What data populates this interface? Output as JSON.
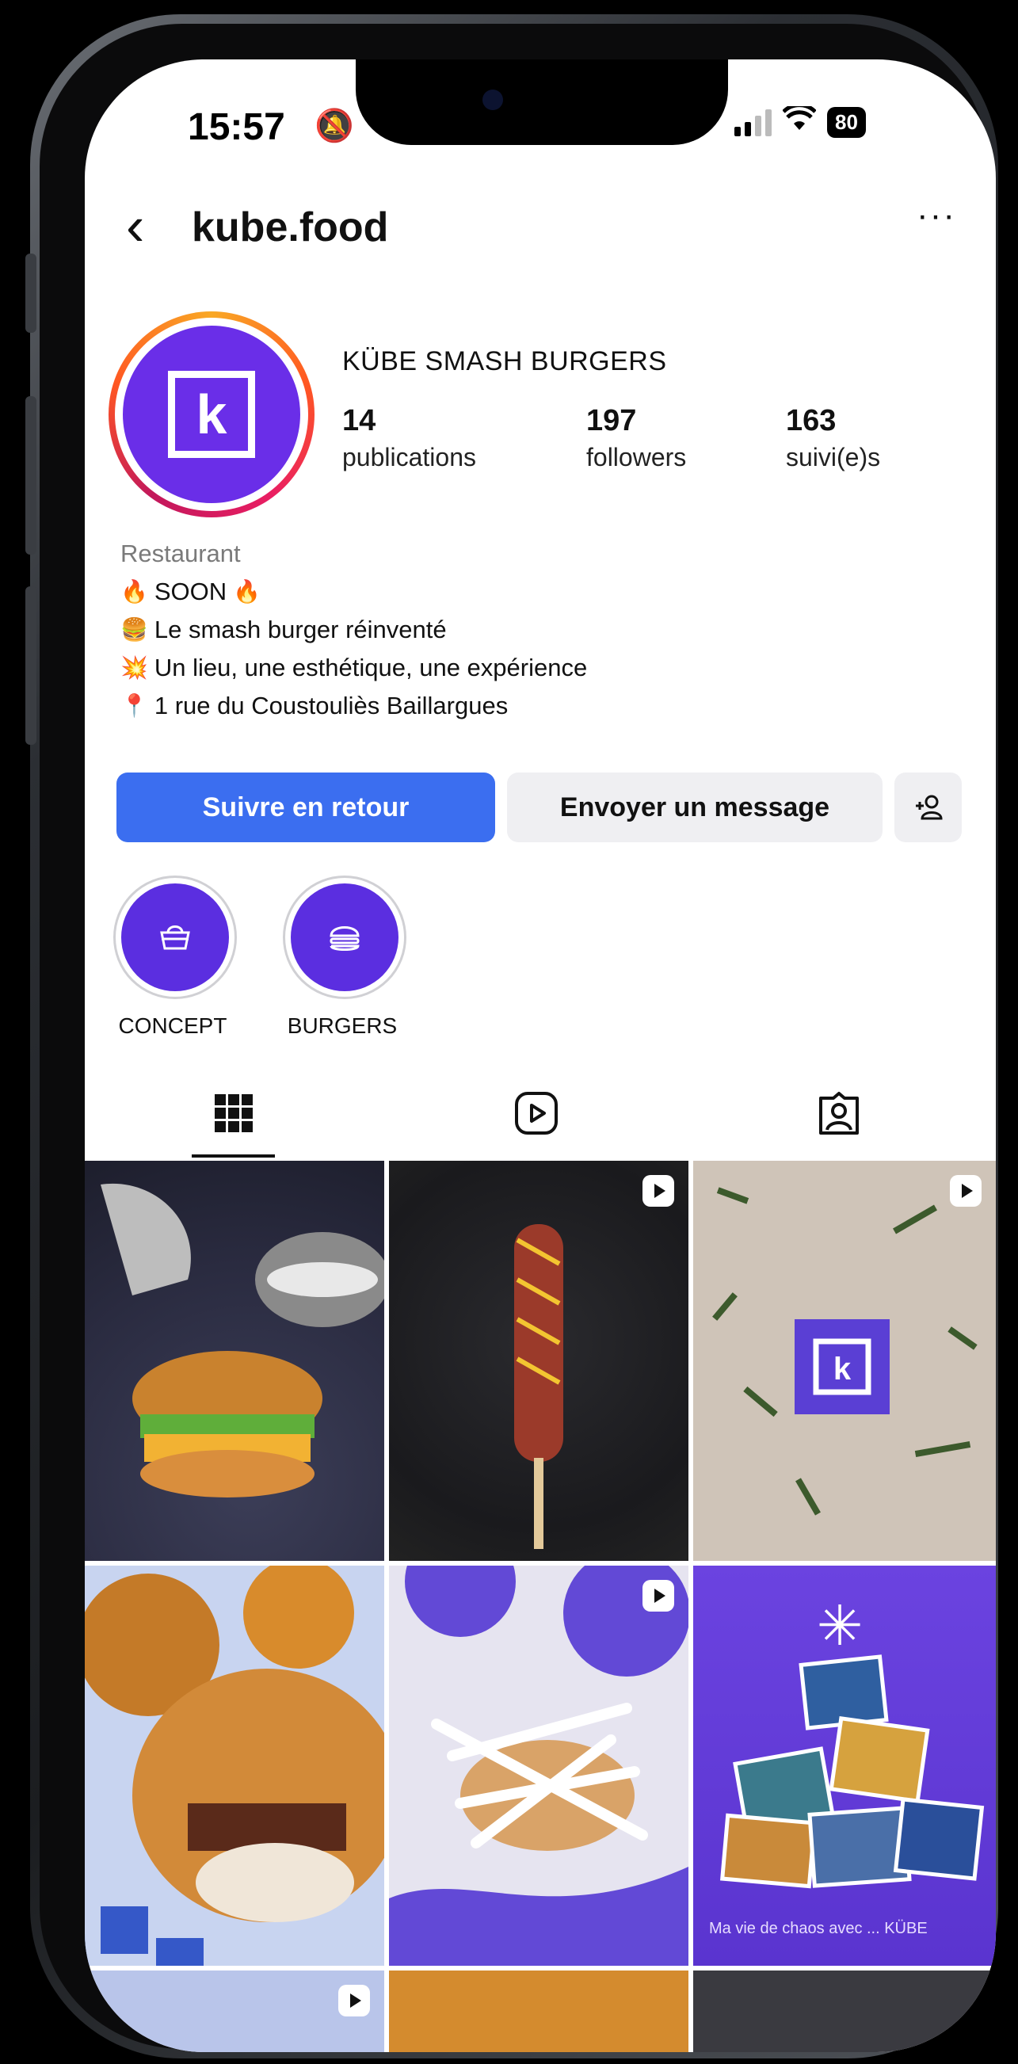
{
  "status_bar": {
    "time": "15:57",
    "battery": "80"
  },
  "header": {
    "username": "kube.food",
    "more": "···"
  },
  "profile": {
    "display_name": "KÜBE SMASH BURGERS",
    "stats": [
      {
        "value": "14",
        "label": "publications"
      },
      {
        "value": "197",
        "label": "followers"
      },
      {
        "value": "163",
        "label": "suivi(e)s"
      }
    ],
    "avatar_letter": "k",
    "accent_color": "#6a2ee8"
  },
  "bio": {
    "category": "Restaurant",
    "soon": "SOON",
    "lines": [
      "Le smash burger réinventé",
      "Un lieu, une esthétique, une expérience",
      "1 rue du Coustouliès Baillargues"
    ]
  },
  "actions": {
    "follow_back": "Suivre en retour",
    "message": "Envoyer un message",
    "add_person_icon": "add-person-icon",
    "follow_color": "#3b6ef0"
  },
  "highlights": [
    {
      "label": "CONCEPT",
      "icon": "basket-icon"
    },
    {
      "label": "BURGERS",
      "icon": "burger-icon"
    }
  ],
  "tabs": [
    {
      "name": "grid-tab",
      "icon": "grid-icon"
    },
    {
      "name": "reels-tab",
      "icon": "reels-icon"
    },
    {
      "name": "tagged-tab",
      "icon": "tagged-icon"
    }
  ],
  "posts": [
    {
      "name": "post-burger-lips",
      "video": false
    },
    {
      "name": "post-corndog",
      "video": true
    },
    {
      "name": "post-logo-herbs",
      "video": true
    },
    {
      "name": "post-burger-onion-rings",
      "video": false
    },
    {
      "name": "post-burger-sauce",
      "video": true
    },
    {
      "name": "post-photo-collage",
      "video": false,
      "caption": "Ma vie de chaos avec ... KÜBE"
    }
  ]
}
